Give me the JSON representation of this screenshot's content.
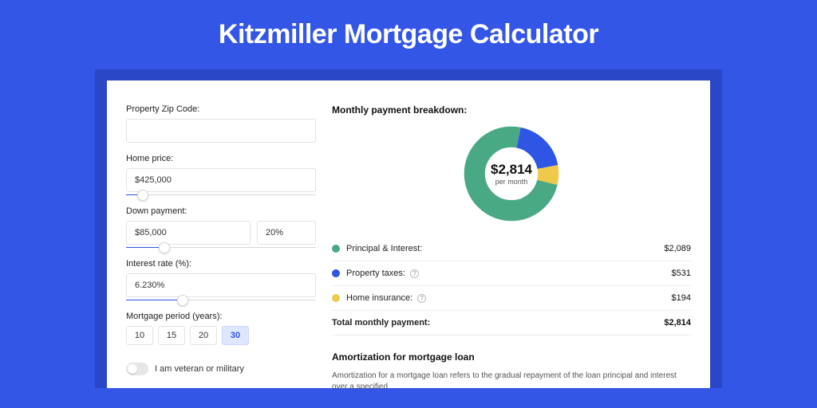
{
  "title": "Kitzmiller Mortgage Calculator",
  "form": {
    "zip_label": "Property Zip Code:",
    "zip_value": "",
    "price_label": "Home price:",
    "price_value": "$425,000",
    "price_slider_pct": 9,
    "down_label": "Down payment:",
    "down_value": "$85,000",
    "down_pct_value": "20%",
    "down_slider_pct": 20,
    "rate_label": "Interest rate (%):",
    "rate_value": "6.230%",
    "rate_slider_pct": 30,
    "period_label": "Mortgage period (years):",
    "periods": [
      "10",
      "15",
      "20",
      "30"
    ],
    "period_selected": "30",
    "veteran_label": "I am veteran or military"
  },
  "breakdown": {
    "title": "Monthly payment breakdown:",
    "center_amount": "$2,814",
    "center_sub": "per month",
    "items": [
      {
        "label": "Principal & Interest:",
        "value": "$2,089",
        "color": "green",
        "info": false
      },
      {
        "label": "Property taxes:",
        "value": "$531",
        "color": "blue",
        "info": true
      },
      {
        "label": "Home insurance:",
        "value": "$194",
        "color": "yellow",
        "info": true
      }
    ],
    "total_label": "Total monthly payment:",
    "total_value": "$2,814"
  },
  "amort": {
    "title": "Amortization for mortgage loan",
    "text": "Amortization for a mortgage loan refers to the gradual repayment of the loan principal and interest over a specified"
  },
  "chart_data": {
    "type": "pie",
    "title": "Monthly payment breakdown",
    "unit": "$",
    "series": [
      {
        "name": "Principal & Interest",
        "value": 2089,
        "share_pct": 74.2,
        "color": "#4aa985"
      },
      {
        "name": "Property taxes",
        "value": 531,
        "share_pct": 18.9,
        "color": "#2e55e4"
      },
      {
        "name": "Home insurance",
        "value": 194,
        "share_pct": 6.9,
        "color": "#efc94c"
      }
    ],
    "total": 2814,
    "inner_radius_ratio": 0.62
  }
}
